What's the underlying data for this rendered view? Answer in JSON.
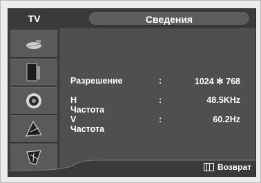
{
  "header": {
    "tv_label": "TV",
    "title": "Сведения"
  },
  "sidebar": {
    "items": [
      {
        "icon": "antenna-icon"
      },
      {
        "icon": "picture-icon"
      },
      {
        "icon": "sound-icon"
      },
      {
        "icon": "channel-icon"
      },
      {
        "icon": "setup-icon"
      }
    ]
  },
  "info": {
    "rows": [
      {
        "label": "Разрешение",
        "colon": ":",
        "value": "1024 ✻ 768"
      },
      {
        "label": "H  Частота",
        "colon": ":",
        "value": "48.5KHz"
      },
      {
        "label": "V  Частота",
        "colon": ":",
        "value": "60.2Hz"
      }
    ]
  },
  "footer": {
    "return_label": "Возврат",
    "return_icon": "grid-return-icon"
  }
}
